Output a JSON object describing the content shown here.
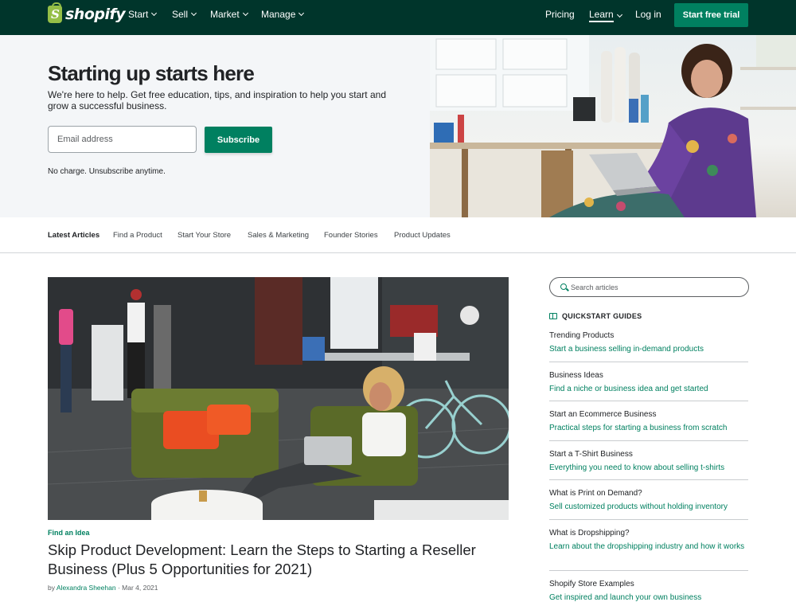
{
  "nav": {
    "logo_text": "shopify",
    "menu": [
      {
        "label": "Start"
      },
      {
        "label": "Sell"
      },
      {
        "label": "Market"
      },
      {
        "label": "Manage"
      }
    ],
    "pricing": "Pricing",
    "learn": "Learn",
    "login": "Log in",
    "trial_button": "Start free trial"
  },
  "hero": {
    "title": "Starting up starts here",
    "subtitle": "We're here to help. Get free education, tips, and inspiration to help you start and grow a successful business.",
    "email_placeholder": "Email address",
    "subscribe": "Subscribe",
    "note": "No charge. Unsubscribe anytime."
  },
  "tabs": [
    {
      "label": "Latest Articles",
      "active": true
    },
    {
      "label": "Find a Product"
    },
    {
      "label": "Start Your Store"
    },
    {
      "label": "Sales & Marketing"
    },
    {
      "label": "Founder Stories"
    },
    {
      "label": "Product Updates"
    }
  ],
  "featured": {
    "category": "Find an Idea",
    "title": "Skip Product Development: Learn the Steps to Starting a Reseller Business (Plus 5 Opportunities for 2021)",
    "by": "by",
    "author": "Alexandra Sheehan",
    "separator": "·",
    "date": "Mar 4, 2021"
  },
  "sidebar": {
    "search_placeholder": "Search articles",
    "quickstart_label": "QUICKSTART GUIDES",
    "guides": [
      {
        "title": "Trending Products",
        "desc": "Start a business selling in-demand products"
      },
      {
        "title": "Business Ideas",
        "desc": "Find a niche or business idea and get started"
      },
      {
        "title": "Start an Ecommerce Business",
        "desc": "Practical steps for starting a business from scratch"
      },
      {
        "title": "Start a T-Shirt Business",
        "desc": "Everything you need to know about selling t-shirts"
      },
      {
        "title": "What is Print on Demand?",
        "desc": "Sell customized products without holding inventory"
      },
      {
        "title": "What is Dropshipping?",
        "desc": "Learn about the dropshipping industry and how it works"
      },
      {
        "title": "Shopify Store Examples",
        "desc": "Get inspired and launch your own business"
      }
    ]
  },
  "colors": {
    "nav_bg": "#00352b",
    "brand_green": "#008060",
    "hero_bg": "#f4f6f8"
  }
}
